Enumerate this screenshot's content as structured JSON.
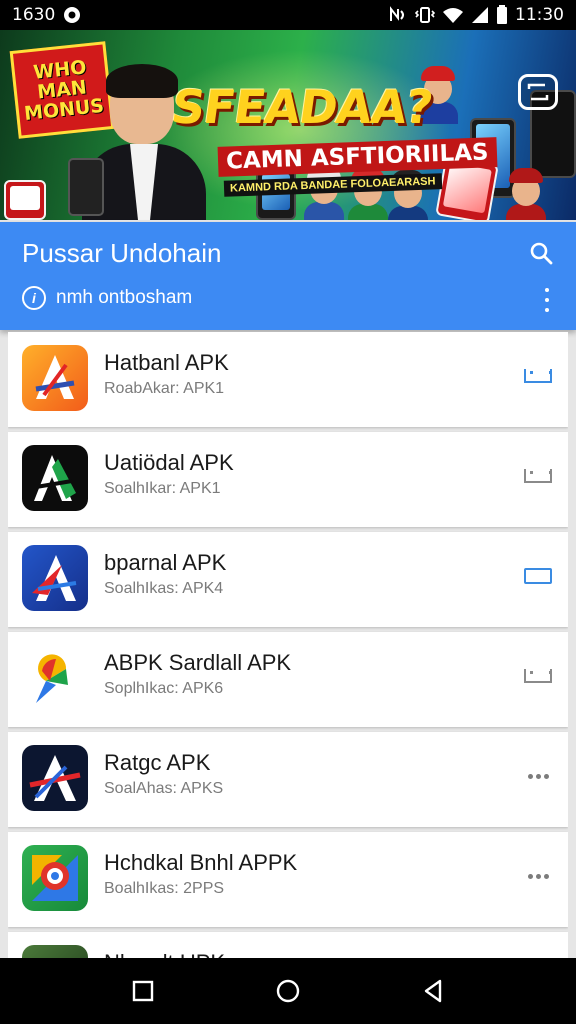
{
  "status_bar": {
    "time_left": "1630",
    "time_right": "11:30",
    "icons": [
      "nfc-icon",
      "vibrate-icon",
      "wifi-icon",
      "signal-icon",
      "battery-icon"
    ]
  },
  "banner": {
    "promo_badge": "WHO MAN MONUS",
    "headline": "SFEADAA?",
    "subheadline": "CAMN ASFTIORIILAS",
    "tagline": "KAMND RDA BANDAE FOLOAEARASH"
  },
  "header": {
    "title": "Pussar Undohain",
    "subtitle": "nmh ontbosham",
    "subtitle_icon_glyph": "i",
    "accent_color": "#3d8af3"
  },
  "apps": [
    {
      "name": "Hatbanl APK",
      "meta": "RoabAkar: APK1",
      "icon": "orange-a-app-icon",
      "action": "download-icon"
    },
    {
      "name": "Uatiödal APK",
      "meta": "SoalhIkar: APK1",
      "icon": "green-a-app-icon",
      "action": "download-icon"
    },
    {
      "name": "bparnal APK",
      "meta": "SoalhIkas: APK4",
      "icon": "blue-a-app-icon",
      "action": "open-icon"
    },
    {
      "name": "ABPK Sardlall APK",
      "meta": "SoplhIkac: APK6",
      "icon": "color-pin-app-icon",
      "action": "download-icon"
    },
    {
      "name": "Ratgc APK",
      "meta": "SoalAhas: APKS",
      "icon": "dark-a-app-icon",
      "action": "more-icon"
    },
    {
      "name": "Hchdkal Bnhl APPK",
      "meta": "BoalhIkas: 2PPS",
      "icon": "maps-style-app-icon",
      "action": "more-icon"
    },
    {
      "name": "Nkaadt UPK",
      "meta": "",
      "icon": "green-photo-app-icon",
      "action": ""
    }
  ],
  "nav_bar": {
    "buttons": [
      "recents-icon",
      "home-icon",
      "back-icon"
    ]
  }
}
